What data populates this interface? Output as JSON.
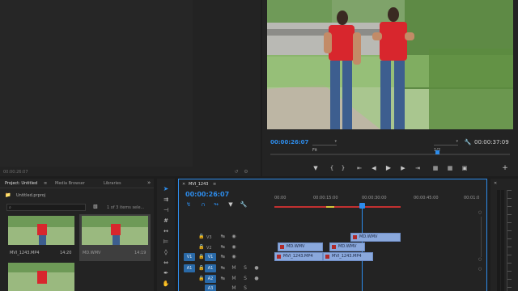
{
  "source_monitor": {
    "timecode": "00:00:26:07"
  },
  "program_monitor": {
    "current_time": "00:00:26:07",
    "fit_label": "Fit",
    "resolution": "1/2",
    "duration": "00:00:37:09"
  },
  "project_panel": {
    "tabs": [
      "Project: Untitled",
      "Media Browser",
      "Libraries"
    ],
    "filename": "Untitled.prproj",
    "items_selected": "1 of 3 items sele...",
    "search_placeholder": "",
    "clips": [
      {
        "name": "MVI_1243.MP4",
        "duration": "14:20"
      },
      {
        "name": "MD.WMV",
        "duration": "14:19"
      }
    ]
  },
  "timeline": {
    "sequence_name": "MVI_1243",
    "timecode": "00:00:26:07",
    "ruler": [
      "00:00",
      "00:00:15:00",
      "00:00:30:00",
      "00:00:45:00",
      "00:01:0"
    ],
    "tracks": {
      "video": [
        "V3",
        "V2",
        "V1"
      ],
      "audio": [
        "A1",
        "A2",
        "A3"
      ],
      "v1_target": "V1",
      "a1_target": "A1",
      "mute": "M",
      "solo": "S"
    },
    "clips": {
      "v3": "MD.WMV",
      "v2_a": "MD.WMV",
      "v2_b": "MD.WMV",
      "v1_a": "MVI_1243.MP4",
      "v1_b": "MVI_1243.MP4"
    },
    "playhead_fraction": 0.41
  },
  "colors": {
    "accent_blue": "#2d8ceb",
    "clip_blue": "#8aa8dc",
    "panel_bg": "#232323",
    "app_bg": "#1d1d1d"
  }
}
